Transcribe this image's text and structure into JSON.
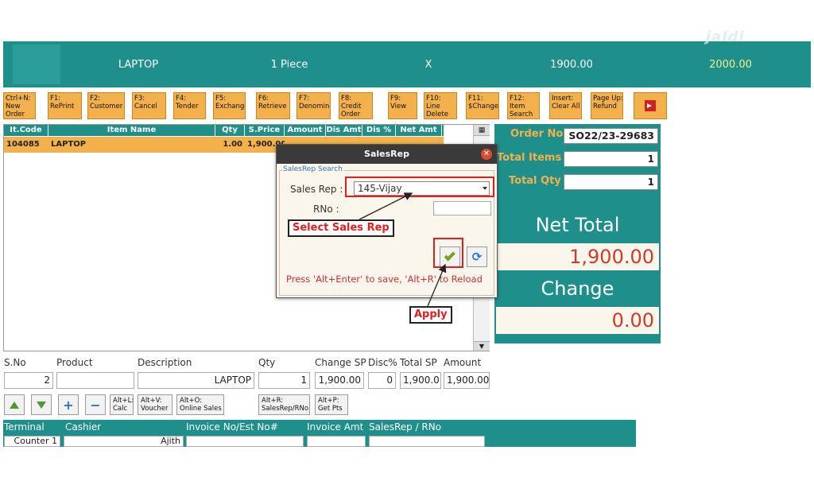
{
  "topbar": {
    "item": "LAPTOP",
    "qty": "1 Piece",
    "multiply": "X",
    "price": "1900.00",
    "total": "2000.00",
    "watermark": "jaldi"
  },
  "function_keys": [
    {
      "label": "Ctrl+N:\nNew\nOrder"
    },
    {
      "label": "F1:\nRePrint"
    },
    {
      "label": "F2:\nCustomer"
    },
    {
      "label": "F3:\nCancel"
    },
    {
      "label": "F4:\nTender"
    },
    {
      "label": "F5:\nExchange"
    },
    {
      "label": "F6:\nRetrieve"
    },
    {
      "label": "F7:\nDenomina"
    },
    {
      "label": "F8:\nCredit\nOrder"
    },
    {
      "label": "F9:\nView"
    },
    {
      "label": "F10:\nLine\nDelete"
    },
    {
      "label": "F11:\n$Change"
    },
    {
      "label": "F12:\nItem\nSearch"
    },
    {
      "label": "Insert:\nClear All"
    },
    {
      "label": "Page Up:\nRefund"
    }
  ],
  "grid": {
    "headers": [
      "It.Code",
      "Item Name",
      "Qty",
      "S.Price",
      "Amount",
      "Dis Amt",
      "Dis %",
      "Net Amt"
    ],
    "row": [
      "104085",
      "LAPTOP",
      "1.00",
      "1,900.00",
      "",
      "",
      "",
      ""
    ]
  },
  "summary": {
    "order_no_label": "Order No",
    "order_no": "SO22/23-29683",
    "total_items_label": "Total Items",
    "total_items": "1",
    "total_qty_label": "Total Qty",
    "total_qty": "1",
    "net_total_label": "Net Total",
    "net_total": "1,900.00",
    "change_label": "Change",
    "change": "0.00"
  },
  "entry": {
    "labels": {
      "sno": "S.No",
      "product": "Product",
      "description": "Description",
      "qty": "Qty",
      "change_sp": "Change SP",
      "disc": "Disc%",
      "total_sp": "Total SP",
      "amount": "Amount"
    },
    "values": {
      "sno": "2",
      "product": "",
      "description": "LAPTOP",
      "qty": "1",
      "change_sp": "1,900.00",
      "disc": "0",
      "total_sp": "1,900.0",
      "amount": "1,900.00"
    }
  },
  "small_buttons": {
    "calc": "Alt+L:\nCalc",
    "voucher": "Alt+V:\nVoucher",
    "online": "Alt+O:\nOnline Sales",
    "salesrep": "Alt+R:\nSalesRep/RNo",
    "getpts": "Alt+P:\nGet Pts"
  },
  "footer": {
    "terminal_label": "Terminal",
    "terminal": "Counter 1",
    "cashier_label": "Cashier",
    "cashier": "Ajith",
    "invoice_label": "Invoice No/Est No#",
    "invoice_no": "",
    "invoice_amt_label": "Invoice Amt",
    "invoice_amt": "",
    "salesrep_label": "SalesRep / RNo",
    "salesrep": ""
  },
  "dialog": {
    "title": "SalesRep",
    "close": "✕",
    "group_label": "SalesRep Search",
    "salesrep_label": "Sales Rep :",
    "salesrep_value": "145-Vijay",
    "rno_label": "RNo :",
    "rno_value": "",
    "hint": "Press 'Alt+Enter' to save, 'Alt+R' to Reload"
  },
  "annotations": {
    "select_sales_rep": "Select Sales Rep",
    "apply": "Apply"
  },
  "colors": {
    "teal": "#1f8f8c",
    "orange": "#f4b04a",
    "red": "#e02020"
  }
}
